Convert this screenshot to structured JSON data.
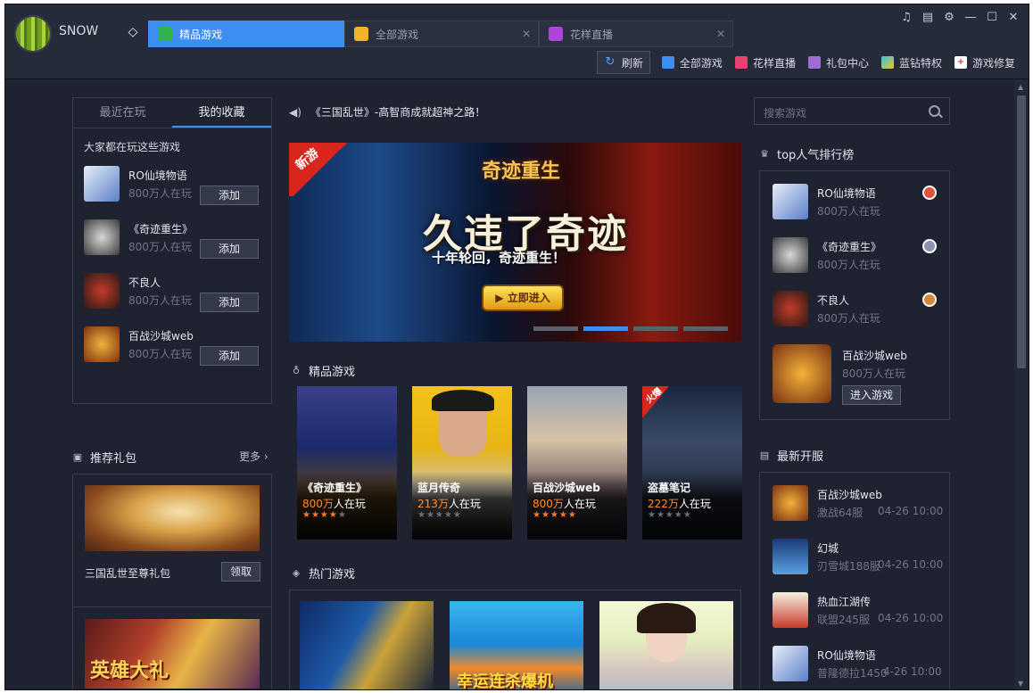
{
  "app": {
    "username": "SNOW"
  },
  "tabs": [
    {
      "label": "精品游戏",
      "active": true,
      "color": "#2fb34a"
    },
    {
      "label": "全部游戏",
      "active": false,
      "color": "#f0b429"
    },
    {
      "label": "花样直播",
      "active": false,
      "color": "#b144d8"
    }
  ],
  "toolbar": {
    "refresh": "刷新",
    "all_games": "全部游戏",
    "live": "花样直播",
    "gift_center": "礼包中心",
    "blue_diamond": "蓝钻特权",
    "repair": "游戏修复"
  },
  "left": {
    "tabs": [
      "最近在玩",
      "我的收藏"
    ],
    "caption": "大家都在玩这些游戏",
    "games": [
      {
        "name": "RO仙境物语",
        "sub": "800万人在玩",
        "action": "添加"
      },
      {
        "name": "《奇迹重生》",
        "sub": "800万人在玩",
        "action": "添加"
      },
      {
        "name": "不良人",
        "sub": "800万人在玩",
        "action": "添加"
      },
      {
        "name": "百战沙城web",
        "sub": "800万人在玩",
        "action": "添加"
      }
    ],
    "gift_title": "推荐礼包",
    "gift_more": "更多",
    "gift_item": {
      "name": "三国乱世至尊礼包",
      "action": "领取"
    },
    "gift_banner_text": "英雄大礼"
  },
  "center": {
    "notice": "《三国乱世》-高智商成就超神之路！",
    "banner": {
      "badge": "新游",
      "logo": "奇迹重生",
      "headline": "久违了奇迹",
      "slogan": "十年轮回，奇迹重生！",
      "cta": "立即进入",
      "slide_active": 2,
      "slides": 4
    },
    "featured_title": "精品游戏",
    "featured": [
      {
        "name": "《奇迹重生》",
        "count": "800万",
        "suffix": "人在玩",
        "stars": 4,
        "hot": ""
      },
      {
        "name": "蓝月传奇",
        "count": "213万",
        "suffix": "人在玩",
        "stars": 0,
        "hot": ""
      },
      {
        "name": "百战沙城web",
        "count": "800万",
        "suffix": "人在玩",
        "stars": 5,
        "hot": ""
      },
      {
        "name": "盗墓笔记",
        "count": "222万",
        "suffix": "人在玩",
        "stars": 0,
        "hot": "火爆"
      }
    ],
    "hot_title": "热门游戏",
    "hot_banner_text": "幸运连杀爆机"
  },
  "right": {
    "search_placeholder": "搜索游戏",
    "rank_title": "top人气排行榜",
    "rank": [
      {
        "name": "RO仙境物语",
        "sub": "800万人在玩",
        "medal": "#e0533a"
      },
      {
        "name": "《奇迹重生》",
        "sub": "800万人在玩",
        "medal": "#8a93b0"
      },
      {
        "name": "不良人",
        "sub": "800万人在玩",
        "medal": "#d7863b"
      }
    ],
    "rank_featured": {
      "name": "百战沙城web",
      "sub": "800万人在玩",
      "action": "进入游戏"
    },
    "new_title": "最新开服",
    "new_servers": [
      {
        "name": "百战沙城web",
        "server": "激战64服",
        "time": "04-26 10:00"
      },
      {
        "name": "幻城",
        "server": "刃雪城188服",
        "time": "04-26 10:00"
      },
      {
        "name": "热血江湖传",
        "server": "联盟245服",
        "time": "04-26 10:00"
      },
      {
        "name": "RO仙境物语",
        "server": "普隆德拉1450",
        "time": "4-26 10:00"
      }
    ]
  },
  "colors": {
    "accent": "#3d8ef0",
    "orange": "#ff8c2e"
  }
}
